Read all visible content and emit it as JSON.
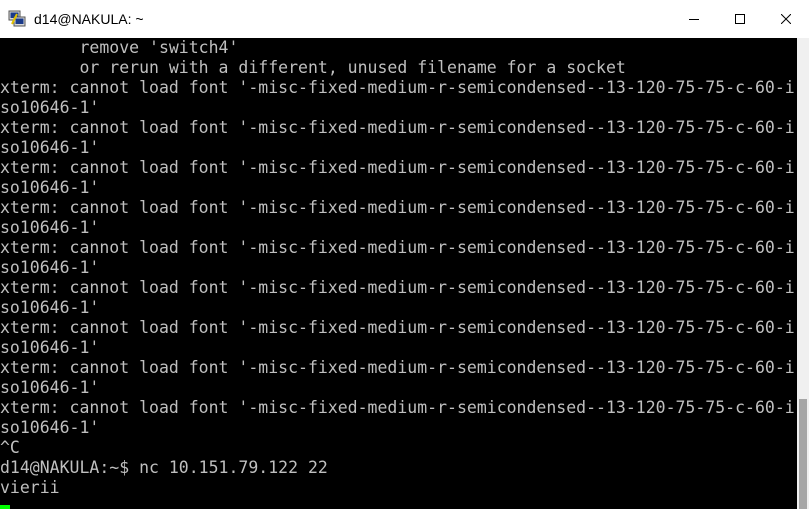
{
  "window": {
    "title": "d14@NAKULA: ~",
    "app_icon": "putty-icon",
    "controls": [
      "minimize-icon",
      "maximize-icon",
      "close-icon"
    ]
  },
  "terminal": {
    "text_color": "#bfbfbf",
    "background": "#000000",
    "cursor_color": "#00ff00",
    "lines": [
      "        remove 'switch4'",
      "        or rerun with a different, unused filename for a socket",
      "xterm: cannot load font '-misc-fixed-medium-r-semicondensed--13-120-75-75-c-60-i",
      "so10646-1'",
      "xterm: cannot load font '-misc-fixed-medium-r-semicondensed--13-120-75-75-c-60-i",
      "so10646-1'",
      "xterm: cannot load font '-misc-fixed-medium-r-semicondensed--13-120-75-75-c-60-i",
      "so10646-1'",
      "xterm: cannot load font '-misc-fixed-medium-r-semicondensed--13-120-75-75-c-60-i",
      "so10646-1'",
      "xterm: cannot load font '-misc-fixed-medium-r-semicondensed--13-120-75-75-c-60-i",
      "so10646-1'",
      "xterm: cannot load font '-misc-fixed-medium-r-semicondensed--13-120-75-75-c-60-i",
      "so10646-1'",
      "xterm: cannot load font '-misc-fixed-medium-r-semicondensed--13-120-75-75-c-60-i",
      "so10646-1'",
      "xterm: cannot load font '-misc-fixed-medium-r-semicondensed--13-120-75-75-c-60-i",
      "so10646-1'",
      "xterm: cannot load font '-misc-fixed-medium-r-semicondensed--13-120-75-75-c-60-i",
      "so10646-1'",
      "^C",
      "d14@NAKULA:~$ nc 10.151.79.122 22",
      "vierii"
    ]
  }
}
